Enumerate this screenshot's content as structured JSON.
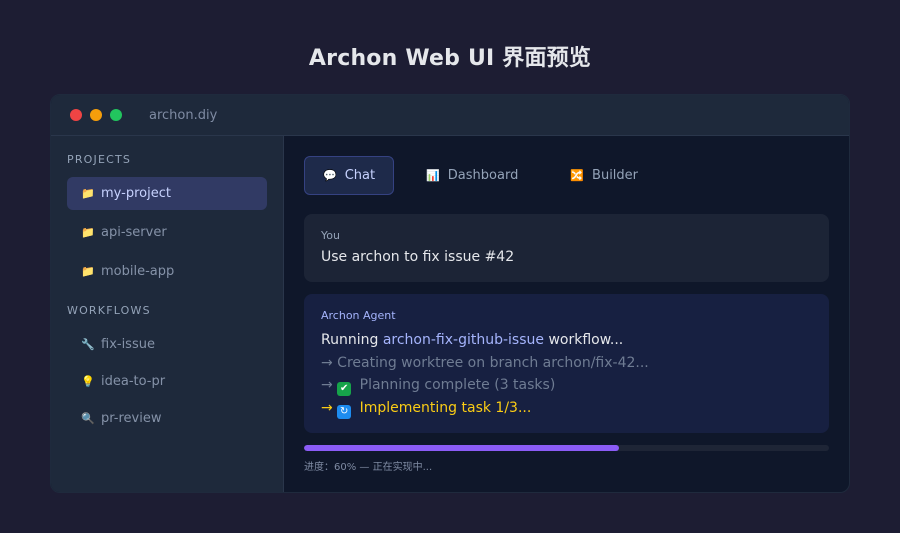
{
  "page_title": "Archon Web UI 界面预览",
  "window": {
    "title": "archon.diy"
  },
  "sidebar": {
    "projects_label": "PROJECTS",
    "projects": [
      {
        "label": "my-project",
        "icon": "folder-icon",
        "active": true
      },
      {
        "label": "api-server",
        "icon": "folder-icon",
        "active": false
      },
      {
        "label": "mobile-app",
        "icon": "folder-icon",
        "active": false
      }
    ],
    "workflows_label": "WORKFLOWS",
    "workflows": [
      {
        "label": "fix-issue",
        "icon": "wrench-icon"
      },
      {
        "label": "idea-to-pr",
        "icon": "lightbulb-icon"
      },
      {
        "label": "pr-review",
        "icon": "magnifier-icon"
      }
    ]
  },
  "tabs": [
    {
      "label": "Chat",
      "icon": "chat-bubble-icon",
      "active": true
    },
    {
      "label": "Dashboard",
      "icon": "bar-chart-icon",
      "active": false
    },
    {
      "label": "Builder",
      "icon": "shuffle-icon",
      "active": false
    }
  ],
  "chat": {
    "user": {
      "name": "You",
      "message": "Use archon to fix issue #42"
    },
    "agent": {
      "name": "Archon Agent",
      "running_prefix": "Running ",
      "workflow_name": "archon-fix-github-issue",
      "running_suffix": " workflow...",
      "step1": "→ Creating worktree on branch archon/fix-42...",
      "step2_arrow": "→ ",
      "step2_text": " Planning complete (3 tasks)",
      "step3_arrow": "→ ",
      "step3_text": " Implementing task 1/3..."
    }
  },
  "progress": {
    "value": 0.6,
    "label": "进度：60% — 正在实现中..."
  },
  "colors": {
    "accent": "#8b5cf6",
    "window_dots": [
      "#ef4444",
      "#f59e0b",
      "#22c55e"
    ],
    "warning": "#facc15"
  }
}
